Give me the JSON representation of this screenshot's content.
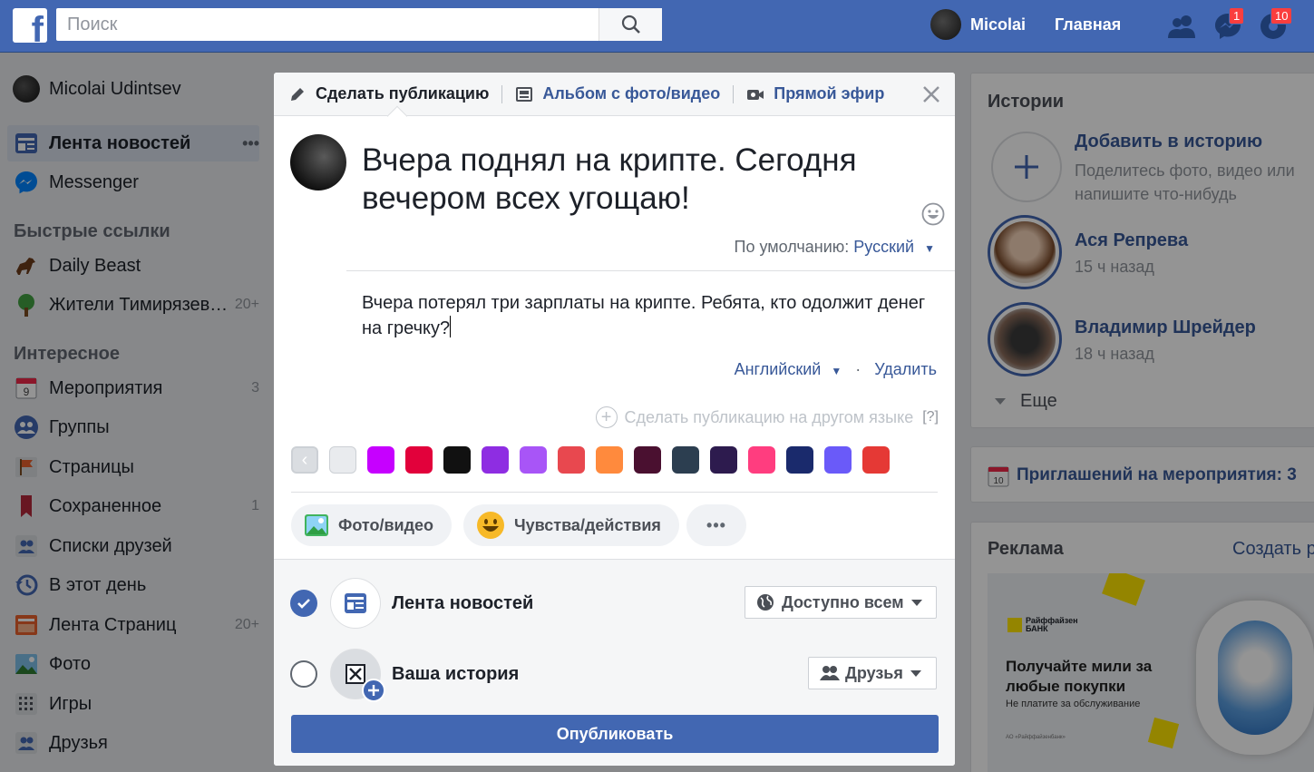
{
  "topbar": {
    "logo": "f",
    "search_placeholder": "Поиск",
    "user_name": "Micolai",
    "home": "Главная",
    "messages_badge": "1",
    "notifications_badge": "10"
  },
  "leftnav": {
    "profile_name": "Micolai Udintsev",
    "news_feed": "Лента новостей",
    "news_feed_more": "•••",
    "messenger": "Messenger",
    "quick_links_header": "Быстрые ссылки",
    "quick_links": [
      {
        "label": "Daily Beast",
        "count": ""
      },
      {
        "label": "Жители Тимирязевского района",
        "count": "20+"
      }
    ],
    "interesting_header": "Интересное",
    "items": [
      {
        "label": "Мероприятия",
        "count": "3"
      },
      {
        "label": "Группы",
        "count": ""
      },
      {
        "label": "Страницы",
        "count": ""
      },
      {
        "label": "Сохраненное",
        "count": "1"
      },
      {
        "label": "Списки друзей",
        "count": ""
      },
      {
        "label": "В этот день",
        "count": ""
      },
      {
        "label": "Лента Страниц",
        "count": "20+"
      },
      {
        "label": "Фото",
        "count": ""
      },
      {
        "label": "Игры",
        "count": ""
      },
      {
        "label": "Друзья",
        "count": ""
      }
    ]
  },
  "right": {
    "stories_title": "Истории",
    "add_story_title": "Добавить в историю",
    "add_story_desc": "Поделитесь фото, видео или напишите что-нибудь",
    "stories": [
      {
        "name": "Ася Репрева",
        "time": "15 ч назад"
      },
      {
        "name": "Владимир Шрейдер",
        "time": "18 ч назад"
      }
    ],
    "more": "Еще",
    "invites": "Приглашений на мероприятия: 3",
    "ads_title": "Реклама",
    "ads_create": "Создать р",
    "ad": {
      "bank": "Райффайзен БАНК",
      "headline": "Получайте мили за любые покупки",
      "sub": "Не платите за обслуживание",
      "fine": "АО «Райффайзенбанк»"
    }
  },
  "modal": {
    "tab_post": "Сделать публикацию",
    "tab_album": "Альбом с фото/видео",
    "tab_live": "Прямой эфир",
    "post_text": "Вчера поднял на крипте. Сегодня вечером всех угощаю!",
    "default_lang_label": "По умолчанию:",
    "default_lang": "Русский",
    "second_text": "Вчера потерял три зарплаты на крипте. Ребята, кто одолжит денег на гречку?",
    "second_lang": "Английский",
    "delete": "Удалить",
    "other_lang": "Сделать публикацию на другом языке",
    "help": "[?]",
    "swatch_colors": [
      "#e9ebee",
      "#c600ff",
      "#e2013b",
      "#111111",
      "#8e2de2",
      "#a855f7",
      "#e8484f",
      "#ff8a3d",
      "#4a1030",
      "#2c3e50",
      "#2d1b4e",
      "#ff3d7f",
      "#1a2a6c",
      "#6a5af9",
      "#e53935"
    ],
    "photo_video": "Фото/видео",
    "feelings": "Чувства/действия",
    "more": "•••",
    "feed_label": "Лента новостей",
    "feed_privacy": "Доступно всем",
    "story_label": "Ваша история",
    "story_privacy": "Друзья",
    "publish": "Опубликовать"
  }
}
